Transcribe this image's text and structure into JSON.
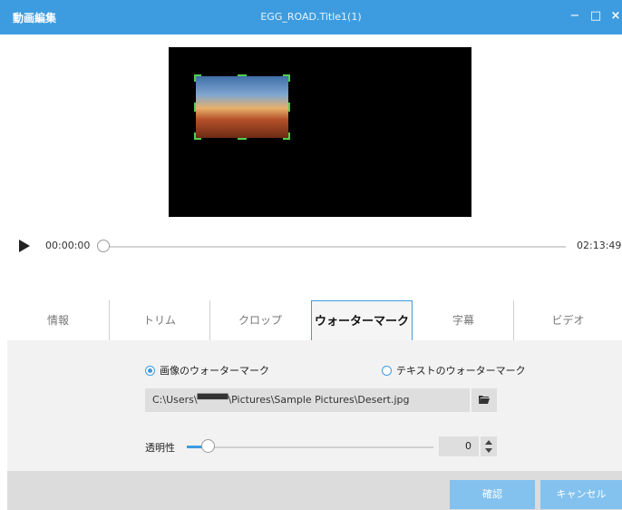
{
  "window": {
    "app_title": "動画編集",
    "doc_title": "EGG_ROAD.Title1(1)",
    "minimize": "−",
    "maximize": "□",
    "close": "×"
  },
  "player": {
    "current_time": "00:00:00",
    "total_time": "02:13:49",
    "progress": 0
  },
  "tabs": [
    {
      "label": "情報",
      "active": false
    },
    {
      "label": "トリム",
      "active": false
    },
    {
      "label": "クロップ",
      "active": false
    },
    {
      "label": "ウォーターマーク",
      "active": true
    },
    {
      "label": "字幕",
      "active": false
    },
    {
      "label": "ビデオ",
      "active": false
    }
  ],
  "watermark": {
    "image_option": "画像のウォーターマーク",
    "text_option": "テキストのウォーターマーク",
    "selected": "image",
    "file_path": "C:\\Users\\▀▀▀▀\\Pictures\\Sample Pictures\\Desert.jpg",
    "opacity_label": "透明性",
    "opacity_value": "0"
  },
  "buttons": {
    "confirm": "確認",
    "cancel": "キャンセル"
  },
  "colors": {
    "accent": "#3d9cdf",
    "button": "#83c2ef",
    "handle": "#4cd24c"
  }
}
